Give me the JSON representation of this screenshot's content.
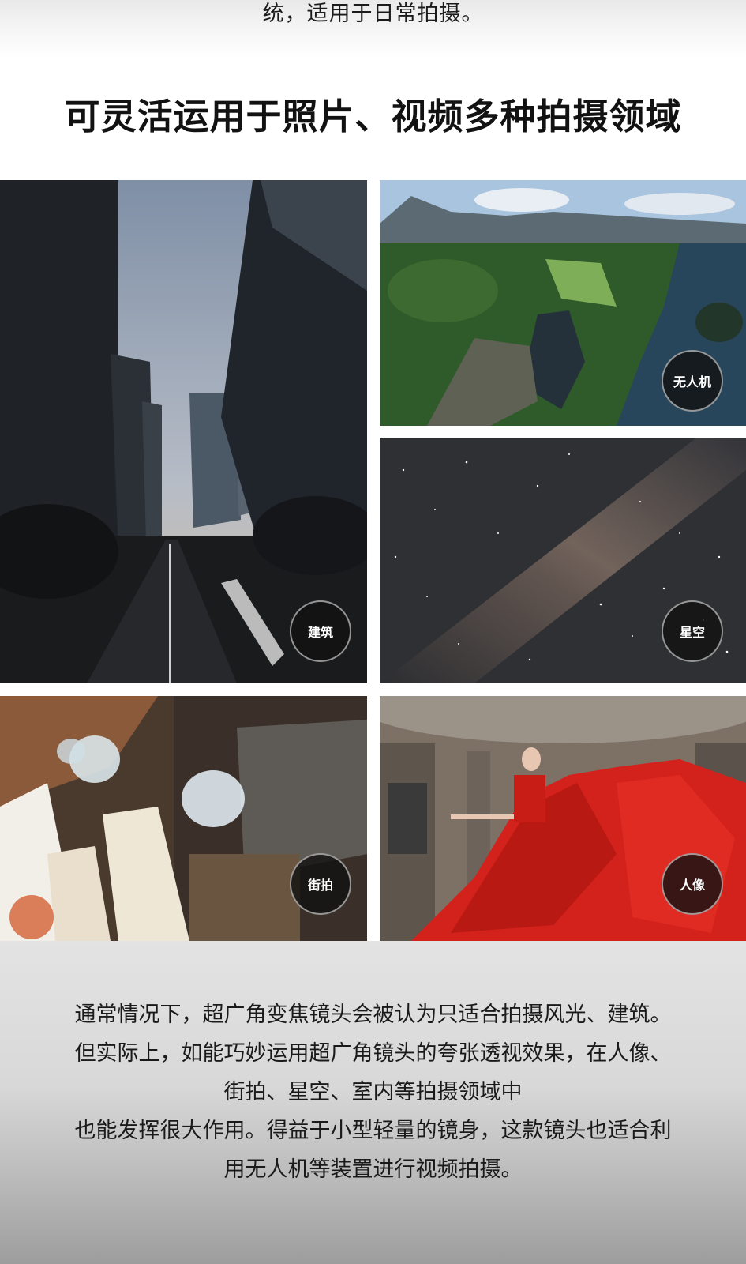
{
  "intro_tail_text": "统，适用于日常拍摄。",
  "section_title": "可灵活运用于照片、视频多种拍摄领域",
  "photos": [
    {
      "id": "architecture",
      "label": "建筑"
    },
    {
      "id": "drone",
      "label": "无人机"
    },
    {
      "id": "starry_sky",
      "label": "星空"
    },
    {
      "id": "street",
      "label": "街拍"
    },
    {
      "id": "portrait",
      "label": "人像"
    }
  ],
  "description_lines": [
    "通常情况下，超广角变焦镜头会被认为只适合拍摄风光、建筑。",
    "但实际上，如能巧妙运用超广角镜头的夸张透视效果，在人像、",
    "街拍、星空、室内等拍摄领域中",
    "也能发挥很大作用。得益于小型轻量的镜身，这款镜头也适合利",
    "用无人机等装置进行视频拍摄。"
  ],
  "colors": {
    "badge_bg": "#121212",
    "badge_text": "#ffffff",
    "title_text": "#121212",
    "body_text": "#1a1a1a"
  }
}
